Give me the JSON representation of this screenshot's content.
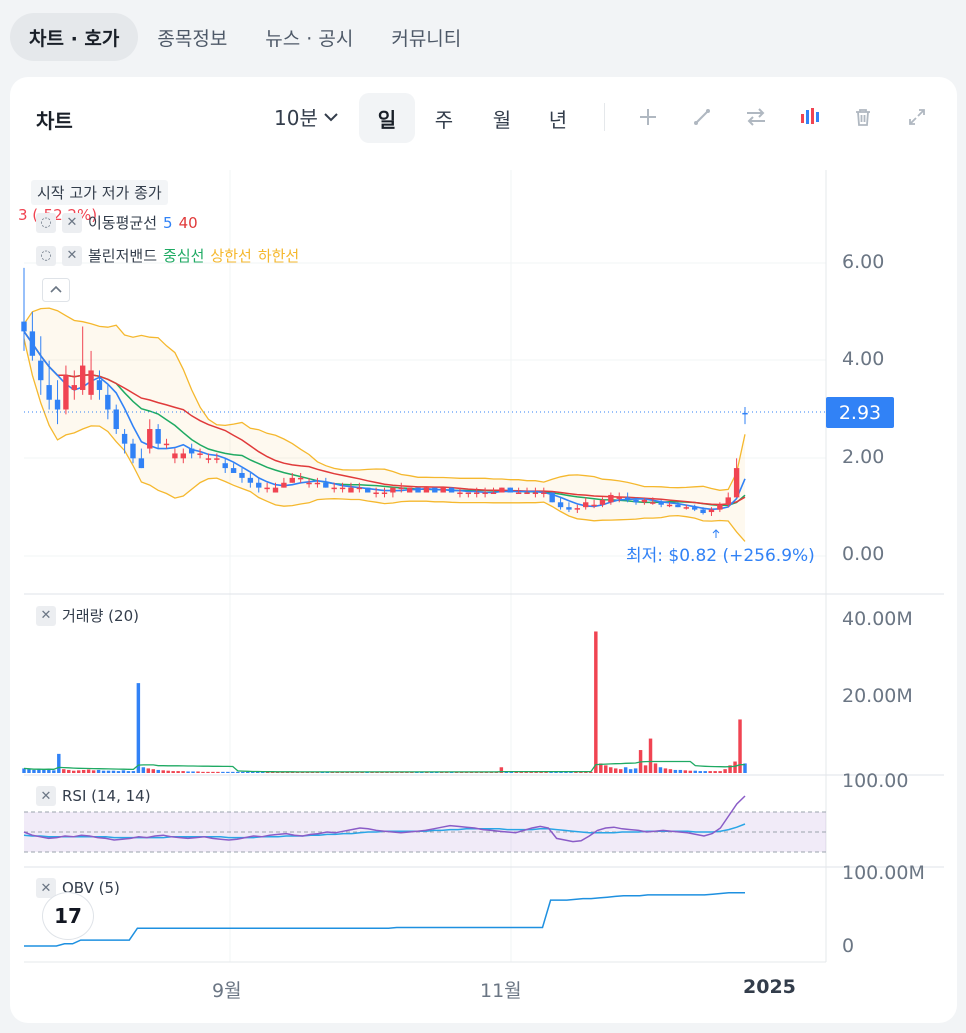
{
  "top_tabs": [
    {
      "label": "차트 · 호가",
      "active": true
    },
    {
      "label": "종목정보",
      "active": false
    },
    {
      "label": "뉴스 · 공시",
      "active": false
    },
    {
      "label": "커뮤니티",
      "active": false
    }
  ],
  "toolbar": {
    "title": "차트",
    "interval": "10분",
    "periods": [
      {
        "label": "일",
        "active": true
      },
      {
        "label": "주",
        "active": false
      },
      {
        "label": "월",
        "active": false
      },
      {
        "label": "년",
        "active": false
      }
    ],
    "tools": [
      "plus-icon",
      "line-tool-icon",
      "compare-icon",
      "indicator-icon",
      "trash-icon",
      "expand-icon"
    ]
  },
  "legends": {
    "ohlc": "시작 고가 저가 종가",
    "high_marker": "3 (-52.2%)",
    "ma_label": "이동평균선",
    "ma_5": "5",
    "ma_40": "40",
    "bb_label": "볼린저밴드",
    "bb_mid": "중심선",
    "bb_upper": "상한선",
    "bb_lower": "하한선",
    "volume": "거래량 (20)",
    "rsi": "RSI (14, 14)",
    "obv": "OBV (5)"
  },
  "price_axis": [
    "6.00",
    "4.00",
    "2.00",
    "0.00"
  ],
  "volume_axis": [
    "40.00M",
    "20.00M"
  ],
  "rsi_axis": "100.00",
  "obv_axis": [
    "100.00M",
    "0"
  ],
  "x_axis": [
    "9월",
    "11월",
    "2025"
  ],
  "current_price": "2.93",
  "low_annotation": "최저: $0.82 (+256.9%)",
  "logo_text": "17",
  "colors": {
    "up": "#f04452",
    "down": "#3182f6",
    "ma5": "#3182f6",
    "ma40": "#e03a3a",
    "bb_mid": "#1faa63",
    "bb_band": "#f5b82e",
    "rsi": "#8a5cc7",
    "rsi_signal": "#2aa5e6",
    "obv": "#1e90e0"
  },
  "chart_data": {
    "type": "candlestick",
    "price_ylim": [
      0,
      7.5
    ],
    "candles": [
      {
        "o": 4.8,
        "h": 5.9,
        "l": 4.2,
        "c": 4.6
      },
      {
        "o": 4.6,
        "h": 5.0,
        "l": 4.0,
        "c": 4.1
      },
      {
        "o": 4.0,
        "h": 4.5,
        "l": 3.3,
        "c": 3.6
      },
      {
        "o": 3.5,
        "h": 4.0,
        "l": 3.0,
        "c": 3.2
      },
      {
        "o": 3.2,
        "h": 3.6,
        "l": 2.7,
        "c": 3.0
      },
      {
        "o": 3.0,
        "h": 3.9,
        "l": 2.9,
        "c": 3.7
      },
      {
        "o": 3.4,
        "h": 3.8,
        "l": 3.2,
        "c": 3.5
      },
      {
        "o": 3.4,
        "h": 4.7,
        "l": 3.3,
        "c": 3.9
      },
      {
        "o": 3.3,
        "h": 4.2,
        "l": 3.2,
        "c": 3.8
      },
      {
        "o": 3.6,
        "h": 3.8,
        "l": 3.2,
        "c": 3.4
      },
      {
        "o": 3.3,
        "h": 3.5,
        "l": 2.8,
        "c": 3.0
      },
      {
        "o": 3.0,
        "h": 3.1,
        "l": 2.5,
        "c": 2.6
      },
      {
        "o": 2.5,
        "h": 2.6,
        "l": 2.1,
        "c": 2.3
      },
      {
        "o": 2.3,
        "h": 2.4,
        "l": 1.9,
        "c": 2.0
      },
      {
        "o": 2.0,
        "h": 2.2,
        "l": 1.8,
        "c": 1.8
      },
      {
        "o": 2.2,
        "h": 2.8,
        "l": 2.1,
        "c": 2.6
      },
      {
        "o": 2.6,
        "h": 2.7,
        "l": 2.2,
        "c": 2.3
      },
      {
        "o": 2.3,
        "h": 2.4,
        "l": 2.2,
        "c": 2.3
      },
      {
        "o": 2.0,
        "h": 2.2,
        "l": 1.9,
        "c": 2.1
      },
      {
        "o": 2.0,
        "h": 2.2,
        "l": 1.9,
        "c": 2.1
      },
      {
        "o": 2.2,
        "h": 2.3,
        "l": 2.0,
        "c": 2.1
      },
      {
        "o": 2.1,
        "h": 2.2,
        "l": 2.0,
        "c": 2.1
      },
      {
        "o": 2.0,
        "h": 2.1,
        "l": 1.9,
        "c": 2.0
      },
      {
        "o": 2.0,
        "h": 2.1,
        "l": 1.9,
        "c": 2.0
      },
      {
        "o": 1.9,
        "h": 2.0,
        "l": 1.7,
        "c": 1.8
      },
      {
        "o": 1.8,
        "h": 1.9,
        "l": 1.7,
        "c": 1.7
      },
      {
        "o": 1.7,
        "h": 1.8,
        "l": 1.5,
        "c": 1.6
      },
      {
        "o": 1.6,
        "h": 1.7,
        "l": 1.4,
        "c": 1.5
      },
      {
        "o": 1.5,
        "h": 1.6,
        "l": 1.3,
        "c": 1.4
      },
      {
        "o": 1.4,
        "h": 1.5,
        "l": 1.3,
        "c": 1.4
      },
      {
        "o": 1.3,
        "h": 1.5,
        "l": 1.3,
        "c": 1.4
      },
      {
        "o": 1.4,
        "h": 1.6,
        "l": 1.4,
        "c": 1.5
      },
      {
        "o": 1.5,
        "h": 1.7,
        "l": 1.5,
        "c": 1.6
      },
      {
        "o": 1.6,
        "h": 1.7,
        "l": 1.5,
        "c": 1.6
      },
      {
        "o": 1.5,
        "h": 1.6,
        "l": 1.4,
        "c": 1.5
      },
      {
        "o": 1.5,
        "h": 1.6,
        "l": 1.4,
        "c": 1.5
      },
      {
        "o": 1.5,
        "h": 1.6,
        "l": 1.4,
        "c": 1.4
      },
      {
        "o": 1.4,
        "h": 1.5,
        "l": 1.3,
        "c": 1.4
      },
      {
        "o": 1.4,
        "h": 1.5,
        "l": 1.3,
        "c": 1.4
      },
      {
        "o": 1.3,
        "h": 1.5,
        "l": 1.3,
        "c": 1.4
      },
      {
        "o": 1.4,
        "h": 1.5,
        "l": 1.3,
        "c": 1.4
      },
      {
        "o": 1.4,
        "h": 1.4,
        "l": 1.3,
        "c": 1.3
      },
      {
        "o": 1.3,
        "h": 1.4,
        "l": 1.2,
        "c": 1.3
      },
      {
        "o": 1.3,
        "h": 1.4,
        "l": 1.2,
        "c": 1.3
      },
      {
        "o": 1.3,
        "h": 1.4,
        "l": 1.2,
        "c": 1.4
      },
      {
        "o": 1.4,
        "h": 1.5,
        "l": 1.3,
        "c": 1.4
      },
      {
        "o": 1.3,
        "h": 1.4,
        "l": 1.3,
        "c": 1.4
      },
      {
        "o": 1.4,
        "h": 1.4,
        "l": 1.3,
        "c": 1.3
      },
      {
        "o": 1.3,
        "h": 1.4,
        "l": 1.3,
        "c": 1.4
      },
      {
        "o": 1.4,
        "h": 1.4,
        "l": 1.3,
        "c": 1.3
      },
      {
        "o": 1.3,
        "h": 1.4,
        "l": 1.3,
        "c": 1.4
      },
      {
        "o": 1.4,
        "h": 1.4,
        "l": 1.3,
        "c": 1.3
      },
      {
        "o": 1.3,
        "h": 1.4,
        "l": 1.2,
        "c": 1.3
      },
      {
        "o": 1.3,
        "h": 1.3,
        "l": 1.2,
        "c": 1.3
      },
      {
        "o": 1.3,
        "h": 1.4,
        "l": 1.2,
        "c": 1.3
      },
      {
        "o": 1.3,
        "h": 1.4,
        "l": 1.2,
        "c": 1.3
      },
      {
        "o": 1.3,
        "h": 1.4,
        "l": 1.3,
        "c": 1.3
      },
      {
        "o": 1.3,
        "h": 1.4,
        "l": 1.3,
        "c": 1.4
      },
      {
        "o": 1.4,
        "h": 1.4,
        "l": 1.3,
        "c": 1.3
      },
      {
        "o": 1.3,
        "h": 1.4,
        "l": 1.3,
        "c": 1.3
      },
      {
        "o": 1.3,
        "h": 1.4,
        "l": 1.3,
        "c": 1.3
      },
      {
        "o": 1.3,
        "h": 1.4,
        "l": 1.2,
        "c": 1.3
      },
      {
        "o": 1.3,
        "h": 1.4,
        "l": 1.2,
        "c": 1.3
      },
      {
        "o": 1.3,
        "h": 1.3,
        "l": 1.1,
        "c": 1.1
      },
      {
        "o": 1.1,
        "h": 1.2,
        "l": 0.95,
        "c": 1.0
      },
      {
        "o": 1.0,
        "h": 1.1,
        "l": 0.9,
        "c": 0.95
      },
      {
        "o": 0.95,
        "h": 1.05,
        "l": 0.88,
        "c": 0.98
      },
      {
        "o": 1.0,
        "h": 1.2,
        "l": 0.95,
        "c": 1.1
      },
      {
        "o": 1.05,
        "h": 1.15,
        "l": 0.98,
        "c": 1.05
      },
      {
        "o": 1.05,
        "h": 1.2,
        "l": 1.0,
        "c": 1.15
      },
      {
        "o": 1.1,
        "h": 1.3,
        "l": 1.05,
        "c": 1.25
      },
      {
        "o": 1.2,
        "h": 1.3,
        "l": 1.1,
        "c": 1.2
      },
      {
        "o": 1.2,
        "h": 1.3,
        "l": 1.1,
        "c": 1.15
      },
      {
        "o": 1.15,
        "h": 1.2,
        "l": 1.05,
        "c": 1.1
      },
      {
        "o": 1.1,
        "h": 1.2,
        "l": 1.05,
        "c": 1.15
      },
      {
        "o": 1.1,
        "h": 1.2,
        "l": 1.05,
        "c": 1.1
      },
      {
        "o": 1.1,
        "h": 1.15,
        "l": 1.0,
        "c": 1.05
      },
      {
        "o": 1.05,
        "h": 1.1,
        "l": 1.0,
        "c": 1.05
      },
      {
        "o": 1.05,
        "h": 1.1,
        "l": 1.0,
        "c": 1.0
      },
      {
        "o": 1.0,
        "h": 1.05,
        "l": 0.95,
        "c": 1.0
      },
      {
        "o": 1.0,
        "h": 1.05,
        "l": 0.92,
        "c": 0.95
      },
      {
        "o": 0.95,
        "h": 1.0,
        "l": 0.85,
        "c": 0.88
      },
      {
        "o": 0.9,
        "h": 1.0,
        "l": 0.82,
        "c": 0.95
      },
      {
        "o": 0.95,
        "h": 1.1,
        "l": 0.9,
        "c": 1.05
      },
      {
        "o": 1.05,
        "h": 1.3,
        "l": 1.0,
        "c": 1.2
      },
      {
        "o": 1.2,
        "h": 2.0,
        "l": 1.2,
        "c": 1.8
      },
      {
        "o": 2.93,
        "h": 3.05,
        "l": 2.7,
        "c": 2.9
      }
    ],
    "volume_ylim": [
      0,
      45
    ],
    "volume": [
      1.2,
      1.0,
      0.8,
      1.0,
      0.9,
      1.1,
      0.7,
      5.0,
      1.0,
      0.8,
      0.6,
      0.7,
      0.8,
      0.9,
      0.7,
      0.8,
      0.6,
      0.6,
      0.6,
      0.5,
      0.7,
      0.5,
      0.5,
      23.5,
      1.5,
      1.2,
      1.0,
      0.8,
      0.7,
      0.6,
      0.5,
      0.5,
      0.5,
      0.4,
      0.4,
      0.4,
      0.3,
      0.3,
      0.3,
      0.3,
      0.3,
      0.3,
      0.3,
      0.3,
      0.3,
      0.3,
      0.3,
      0.3,
      0.3,
      0.3,
      0.3,
      0.3,
      0.3,
      0.3,
      0.3,
      0.3,
      0.3,
      0.3,
      0.3,
      0.3,
      0.3,
      0.3,
      0.3,
      0.3,
      0.3,
      0.3,
      0.3,
      0.3,
      0.3,
      0.3,
      0.3,
      0.3,
      0.3,
      0.3,
      0.3,
      0.3,
      0.3,
      0.3,
      0.3,
      0.3,
      0.3,
      0.3,
      0.3,
      0.3,
      0.3,
      0.3,
      0.3,
      0.3,
      0.3,
      0.3,
      0.3,
      0.3,
      0.3,
      0.3,
      0.3,
      0.3,
      1.5,
      0.3,
      0.3,
      0.3,
      0.3,
      0.3,
      0.3,
      0.3,
      0.3,
      0.3,
      0.3,
      0.3,
      0.3,
      0.3,
      0.3,
      0.3,
      0.3,
      0.3,
      0.3,
      37.0,
      2.5,
      2.0,
      1.5,
      1.2,
      1.0,
      1.5,
      1.0,
      1.2,
      6.0,
      2.0,
      9.0,
      2.5,
      1.5,
      1.2,
      1.0,
      0.8,
      0.8,
      0.7,
      0.6,
      0.6,
      0.5,
      0.5,
      0.5,
      0.5,
      0.5,
      1.0,
      2.0,
      3.0,
      14.0,
      2.5
    ],
    "rsi_ylim": [
      0,
      100
    ],
    "rsi": [
      50,
      46,
      44,
      42,
      43,
      45,
      44,
      46,
      45,
      43,
      42,
      40,
      41,
      42,
      44,
      43,
      45,
      46,
      44,
      43,
      42,
      43,
      44,
      42,
      41,
      40,
      41,
      43,
      45,
      44,
      46,
      47,
      48,
      46,
      45,
      47,
      48,
      50,
      49,
      51,
      53,
      55,
      54,
      52,
      51,
      50,
      49,
      50,
      51,
      52,
      54,
      56,
      58,
      57,
      56,
      55,
      53,
      52,
      51,
      50,
      49,
      52,
      55,
      57,
      55,
      42,
      40,
      38,
      39,
      45,
      52,
      55,
      56,
      54,
      53,
      52,
      50,
      51,
      52,
      51,
      50,
      49,
      47,
      45,
      48,
      55,
      70,
      85,
      95
    ],
    "rsi_signal": [
      46,
      45,
      45,
      44,
      44,
      44,
      44,
      44,
      44,
      44,
      44,
      43,
      43,
      43,
      43,
      43,
      43,
      43,
      44,
      44,
      44,
      44,
      44,
      44,
      44,
      43,
      43,
      43,
      43,
      44,
      44,
      44,
      45,
      45,
      45,
      46,
      46,
      47,
      47,
      48,
      48,
      49,
      50,
      50,
      51,
      51,
      51,
      51,
      51,
      51,
      52,
      52,
      53,
      53,
      54,
      54,
      54,
      54,
      54,
      53,
      53,
      53,
      53,
      54,
      54,
      53,
      52,
      51,
      50,
      49,
      49,
      49,
      49,
      50,
      50,
      50,
      51,
      51,
      51,
      51,
      51,
      51,
      50,
      50,
      50,
      51,
      53,
      56,
      60
    ],
    "obv_ylim": [
      0,
      100
    ],
    "obv": [
      0,
      0,
      0,
      0,
      0,
      3,
      3,
      8,
      8,
      8,
      8,
      8,
      8,
      8,
      24,
      24,
      24,
      24,
      24,
      24,
      24,
      24,
      24,
      24,
      24,
      24,
      24,
      24,
      24,
      24,
      24,
      24,
      24,
      24,
      24,
      24,
      24,
      24,
      24,
      24,
      24,
      24,
      24,
      24,
      24,
      24,
      25,
      25,
      25,
      25,
      25,
      25,
      25,
      25,
      25,
      25,
      25,
      25,
      25,
      25,
      25,
      25,
      25,
      25,
      25,
      62,
      62,
      62,
      63,
      64,
      64,
      65,
      66,
      67,
      68,
      68,
      68,
      69,
      69,
      69,
      69,
      69,
      69,
      69,
      69,
      70,
      71,
      72,
      72,
      72
    ]
  }
}
